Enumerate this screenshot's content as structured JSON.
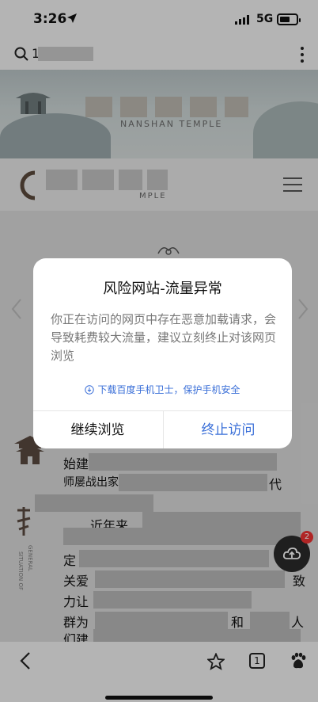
{
  "status": {
    "time": "3:26",
    "network": "5G"
  },
  "urlbar": {
    "url_text": "1"
  },
  "site": {
    "banner_en": "NANSHAN TEMPLE",
    "logo_sub": "MPLE"
  },
  "article": {
    "line1": "始建",
    "line2": "师屡战出家",
    "line2b": "代",
    "line3": "近年来",
    "line4": "定",
    "line5": "关爱",
    "line5b": "致",
    "line6": "力让",
    "line7": "群为",
    "line7b": "和",
    "line7c": "人",
    "line8": "们建",
    "side_en": [
      "GENERAL",
      "SITUATION OF"
    ]
  },
  "fab": {
    "badge_count": "2"
  },
  "bottom": {
    "tab_count": "1"
  },
  "dialog": {
    "title": "风险网站-流量异常",
    "message": "你正在访问的网页中存在恶意加载请求，会导致耗费较大流量，建议立刻终止对该网页浏览",
    "promo": "下载百度手机卫士，保护手机安全",
    "continue_label": "继续浏览",
    "stop_label": "终止访问"
  },
  "colors": {
    "accent_blue": "#3a6fd8",
    "badge_red": "#e33333"
  }
}
